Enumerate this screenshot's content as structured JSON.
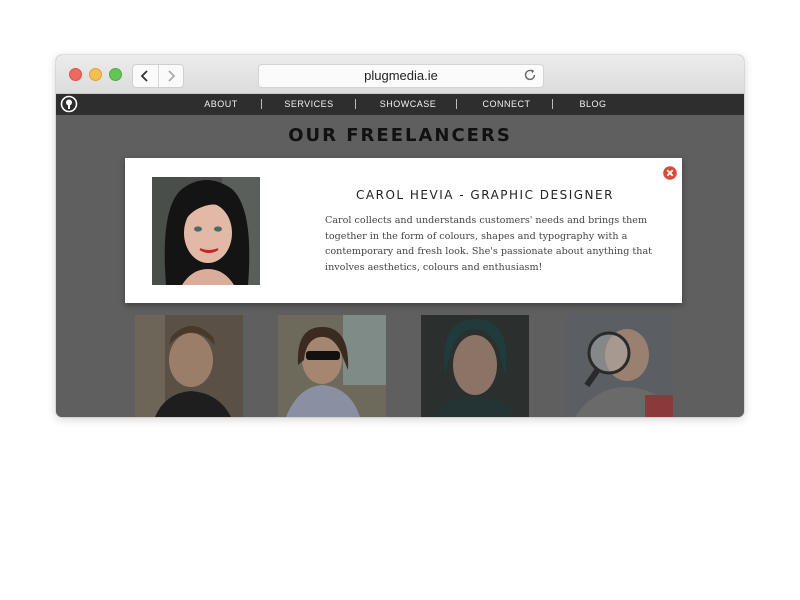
{
  "browser": {
    "url": "plugmedia.ie",
    "back_icon": "chevron-left-icon",
    "forward_icon": "chevron-right-icon",
    "reload_icon": "reload-icon"
  },
  "nav": {
    "logo_icon": "bulb-logo-icon",
    "items": [
      {
        "label": "ABOUT"
      },
      {
        "label": "SERVICES"
      },
      {
        "label": "SHOWCASE"
      },
      {
        "label": "CONNECT"
      },
      {
        "label": "BLOG"
      }
    ]
  },
  "page": {
    "heading": "OUR FREELANCERS"
  },
  "modal": {
    "title": "CAROL HEVIA - GRAPHIC DESIGNER",
    "bio": "Carol collects and understands customers' needs and brings them together in the form of colours, shapes and typography with a contemporary and fresh look. She's passionate about anything that involves aesthetics, colours and enthusiasm!",
    "close_icon": "close-icon"
  },
  "colors": {
    "nav_bg": "#2e2e2e",
    "overlay_bg": "#5f5f5f",
    "close_red": "#d9493c"
  }
}
